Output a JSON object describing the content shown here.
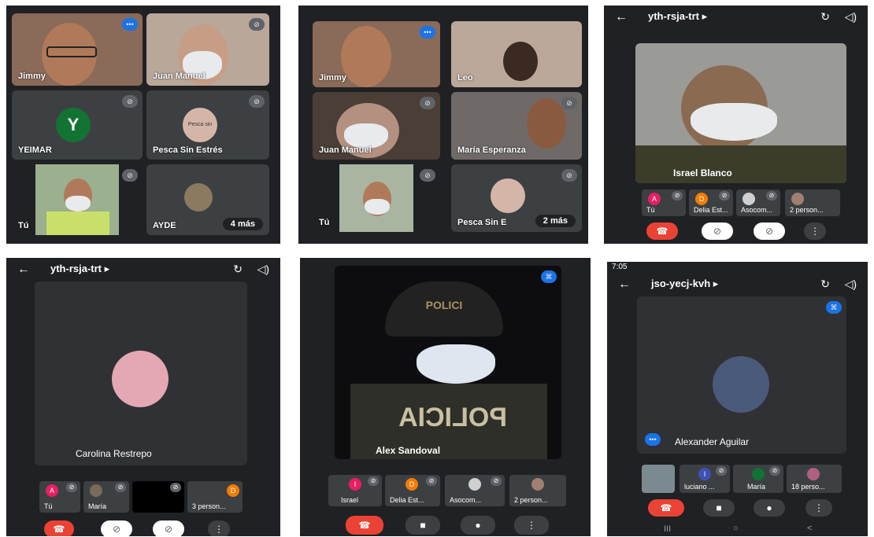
{
  "panel1": {
    "tiles": [
      "Jimmy",
      "Juan Manuel",
      "YEIMAR",
      "Pesca Sin Estrés",
      "Tú",
      "AYDE"
    ],
    "yeimar_initial": "Y",
    "pesca_logo_text": "Pesca sin Estrés",
    "more_label": "4 más",
    "mic_icon": "⊘",
    "speak_icon": "•••"
  },
  "panel2": {
    "tiles": [
      "Jimmy",
      "Leo",
      "Juan Manuel",
      "María Esperanza",
      "Tú",
      "Pesca Sin E"
    ],
    "more_label": "2 más"
  },
  "panel3": {
    "meeting_code": "yth-rsja-trt ▸",
    "main_name": "Israel Blanco",
    "thumbs": [
      "Tú",
      "Delia Est...",
      "Asocom...",
      "2 person..."
    ],
    "thumb_initials": [
      "A",
      "D"
    ]
  },
  "panel4": {
    "meeting_code": "yth-rsja-trt ▸",
    "main_name": "Carolina Restrepo",
    "thumbs": [
      "Tú",
      "María",
      "",
      "3 person..."
    ],
    "thumb_initials": [
      "A",
      "D"
    ]
  },
  "panel5": {
    "main_name": "Alex Sandoval",
    "vest_text": "POLICIA",
    "cap_text": "POLICI",
    "thumbs": [
      "Israel",
      "Delia Est...",
      "Asocom...",
      "2 person..."
    ],
    "thumb_initials": [
      "I",
      "D"
    ]
  },
  "panel6": {
    "status_time": "7:05",
    "meeting_code": "jso-yecj-kvh ▸",
    "main_name": "Alexander Aguilar",
    "thumbs": [
      "",
      "luciano ...",
      "María",
      "18 perso..."
    ],
    "thumb_initials": [
      "l"
    ],
    "nav": [
      "III",
      "○",
      "<"
    ]
  },
  "icons": {
    "back": "←",
    "switch_camera": "↻",
    "volume": "◁)",
    "end_call": "☎",
    "camera_off": "⊘",
    "mic_off": "⊘",
    "camera": "■",
    "mic": "●",
    "more": "⋮",
    "pin": "⌘"
  },
  "colors": {
    "end_call": "#ea4335",
    "speaking": "#1a73e8",
    "tile": "#3c4043",
    "background": "#202124",
    "avatar_pink": "#e91e63",
    "avatar_orange": "#f57c00",
    "avatar_green": "#137333"
  }
}
